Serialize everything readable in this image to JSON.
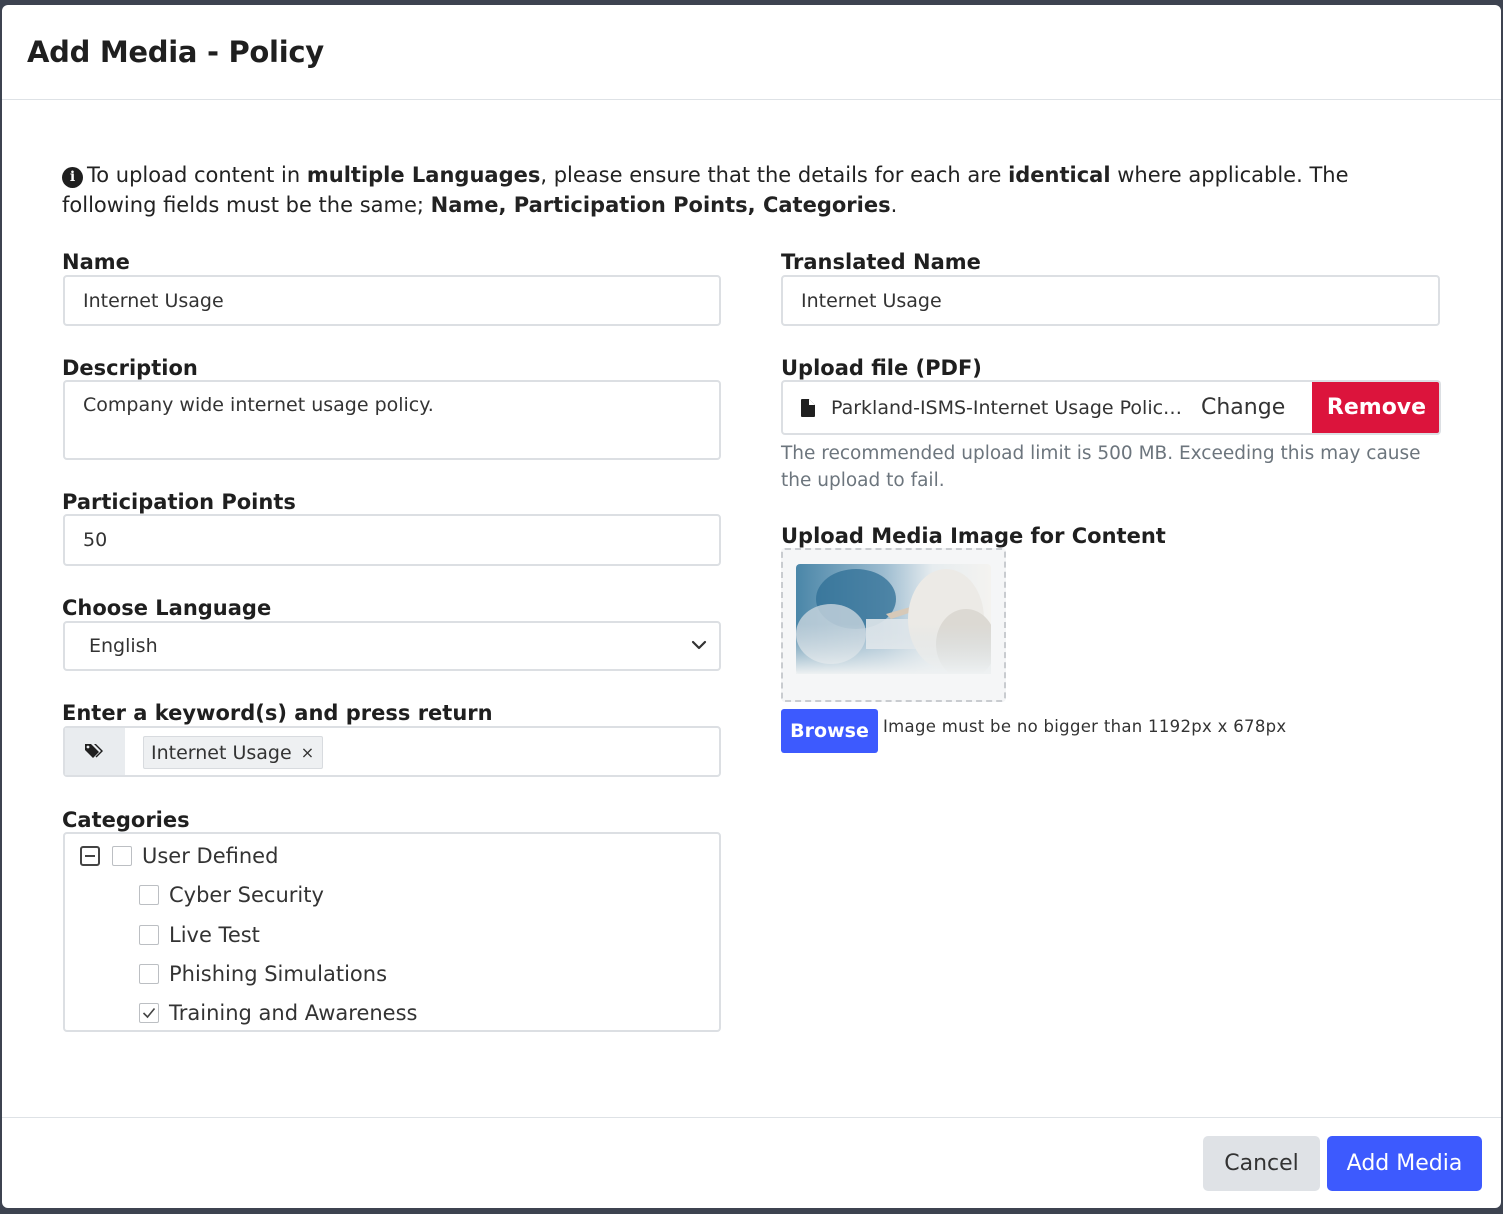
{
  "modal": {
    "title": "Add Media - Policy"
  },
  "notice": {
    "part1": "To upload content in ",
    "bold1": "multiple Languages",
    "part2": ", please ensure that the details for each are ",
    "bold2": "identical",
    "part3": " where applicable. The following fields must be the same; ",
    "bold3": "Name, Participation Points, Categories",
    "part4": "."
  },
  "form": {
    "name_label": "Name",
    "name_value": "Internet Usage",
    "description_label": "Description",
    "description_value": "Company wide internet usage policy.",
    "points_label": "Participation Points",
    "points_value": "50",
    "language_label": "Choose Language",
    "language_value": "English",
    "keywords_label": "Enter a keyword(s) and press return",
    "keyword_tag": "Internet Usage",
    "tag_remove": "×",
    "categories_label": "Categories",
    "categories": {
      "root": "User Defined",
      "children": [
        {
          "label": "Cyber Security",
          "checked": false
        },
        {
          "label": "Live Test",
          "checked": false
        },
        {
          "label": "Phishing Simulations",
          "checked": false
        },
        {
          "label": "Training and Awareness",
          "checked": true
        }
      ]
    },
    "translated_name_label": "Translated Name",
    "translated_name_value": "Internet Usage",
    "upload_label": "Upload file (PDF)",
    "file_name": "Parkland-ISMS-Internet Usage Policy.pdf",
    "change_label": "Change",
    "remove_label": "Remove",
    "upload_help": "The recommended upload limit is 500 MB. Exceeding this may cause the upload to fail.",
    "image_label": "Upload Media Image for Content",
    "browse_label": "Browse",
    "image_note": "Image must be no bigger than 1192px x 678px"
  },
  "footer": {
    "cancel_label": "Cancel",
    "submit_label": "Add Media"
  },
  "colors": {
    "primary": "#3d5afe",
    "danger": "#dc143c",
    "secondary": "#dfe2e6"
  },
  "icons": {
    "info": "info-circle-icon",
    "tags": "tags-icon",
    "file": "file-icon",
    "chevron": "chevron-down-icon",
    "collapse": "minus-square-icon",
    "check": "check-icon"
  }
}
